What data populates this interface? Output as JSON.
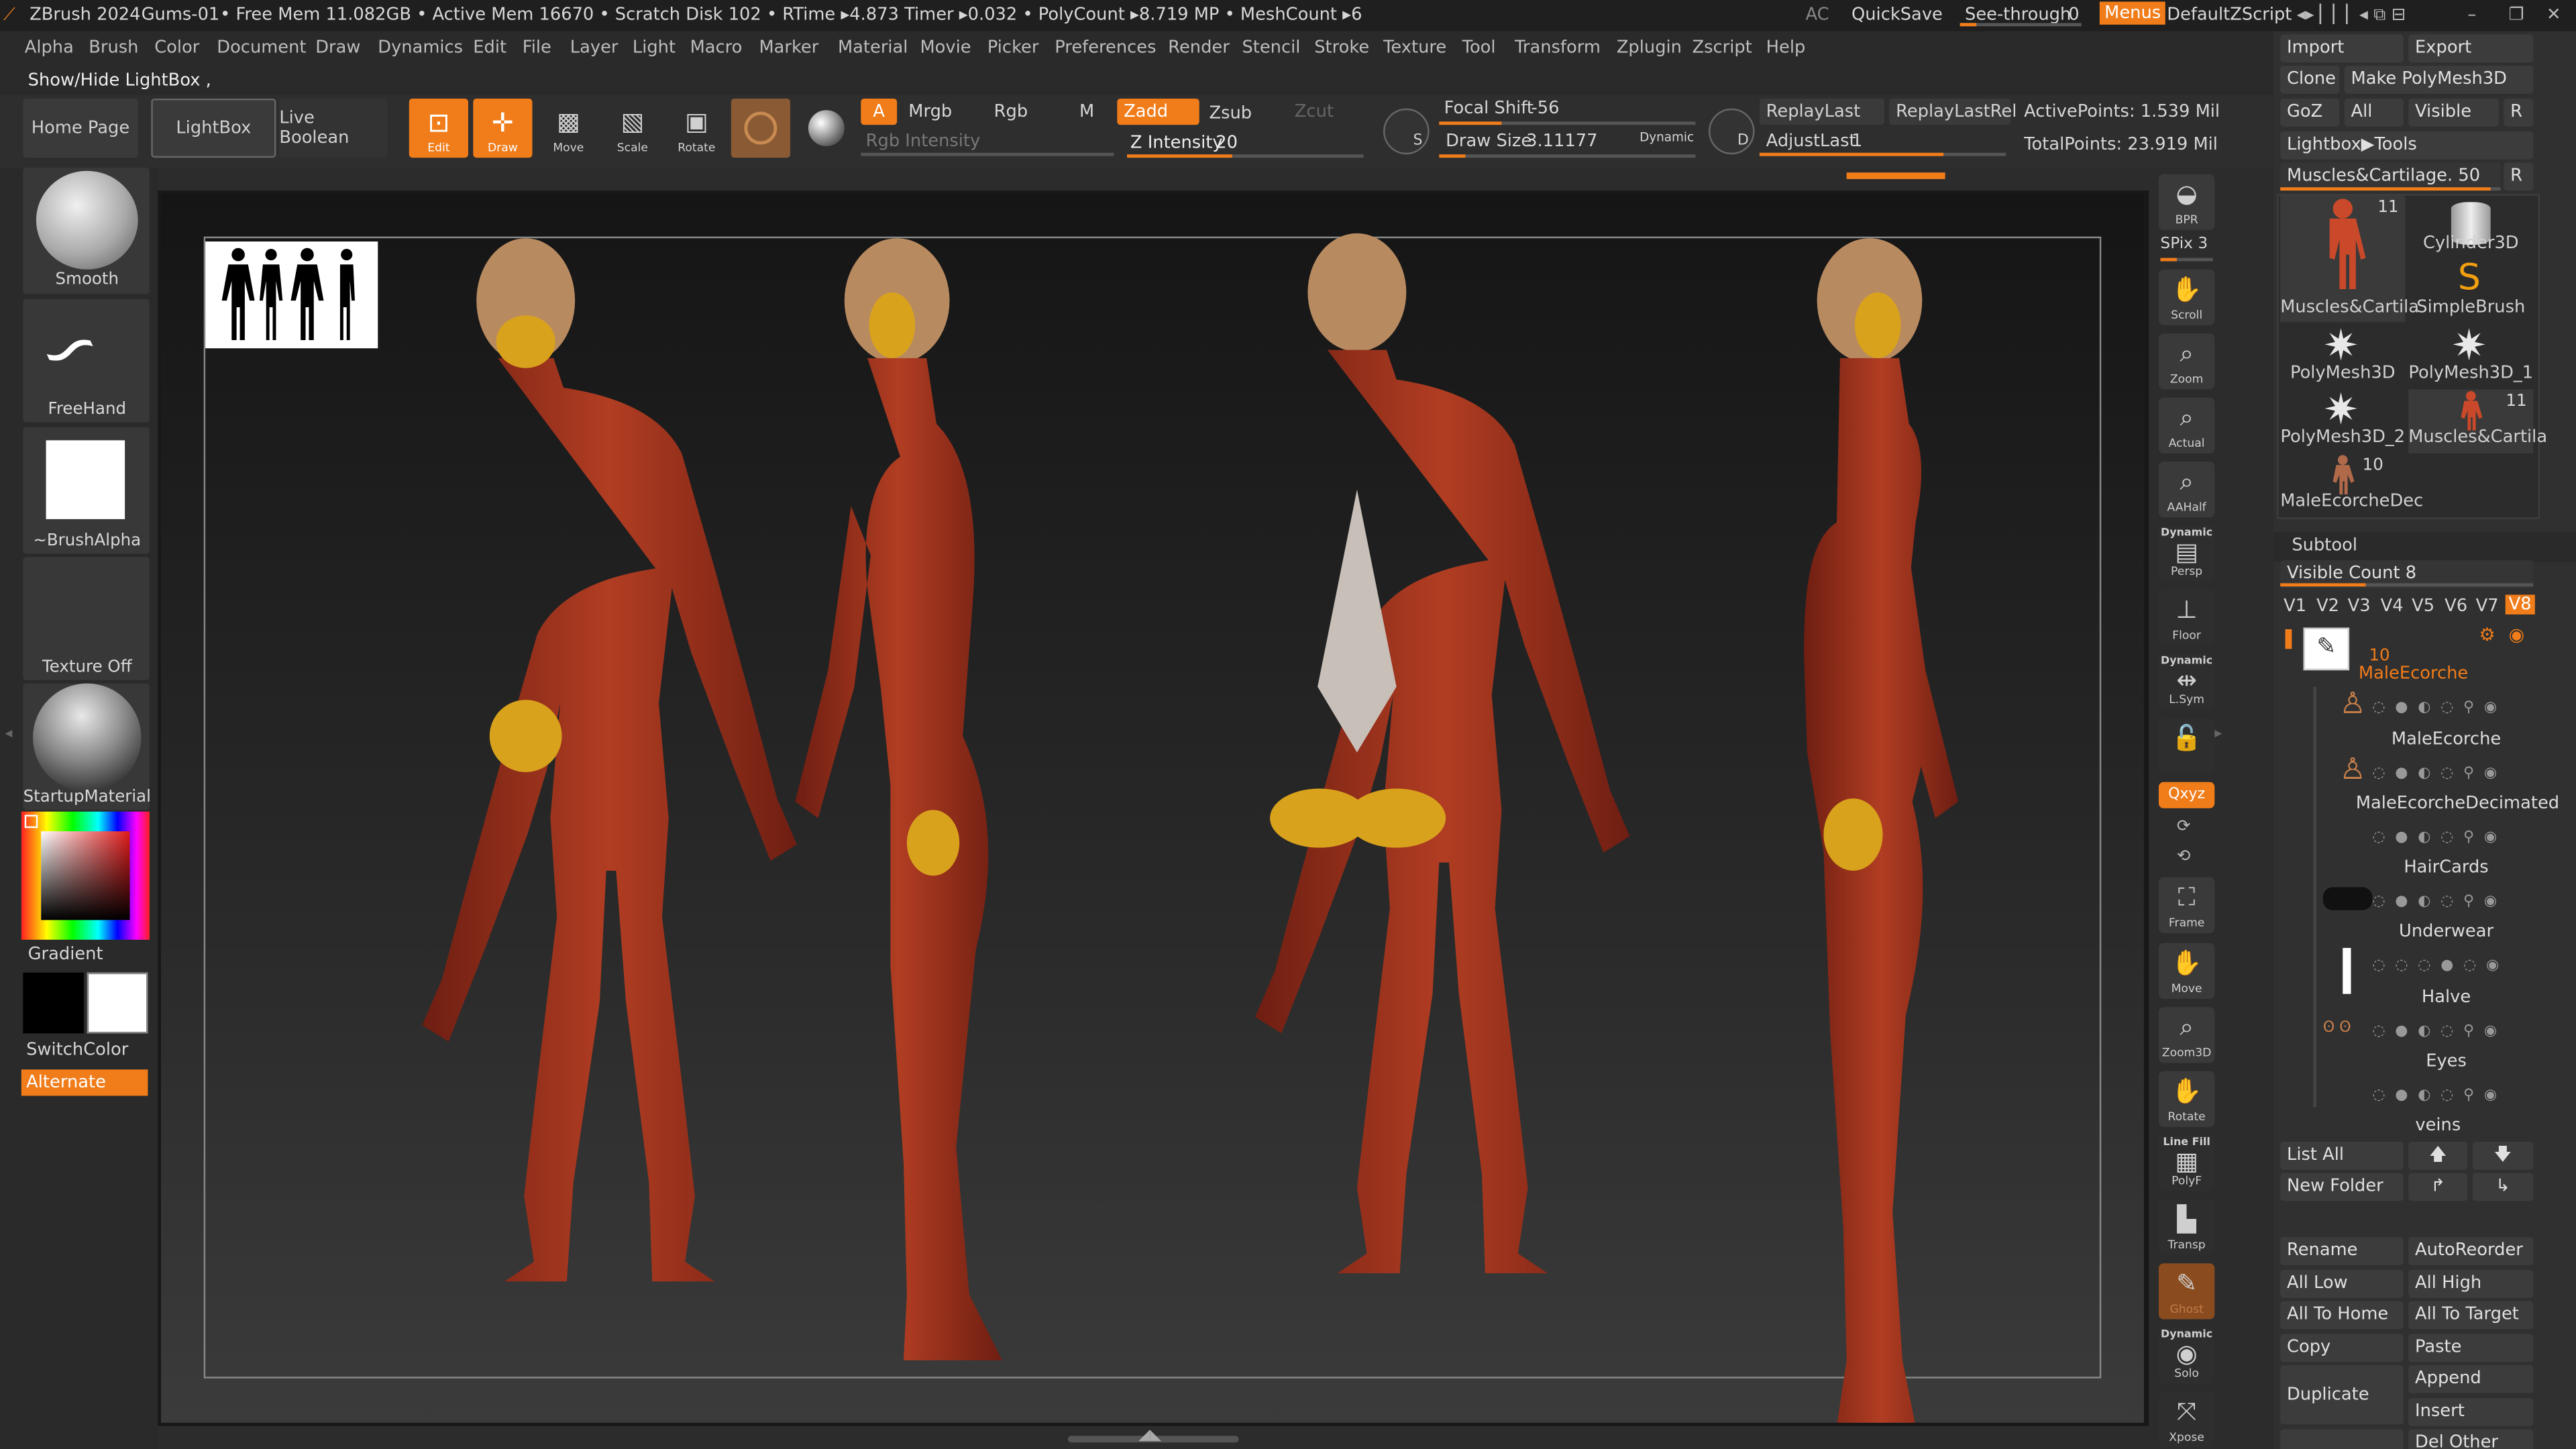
{
  "titlebar": {
    "app": "ZBrush 2024",
    "doc": "Gums-01",
    "stats": "• Free Mem 11.082GB • Active Mem 16670 • Scratch Disk 102 • RTime ▸4.873 Timer ▸0.032 • PolyCount ▸8.719 MP • MeshCount ▸6",
    "ac": "AC",
    "quicksave": "QuickSave",
    "see_through": "See-through",
    "see_through_value": "0",
    "menus": "Menus",
    "default_zscript": "DefaultZScript"
  },
  "menubar": [
    "Alpha",
    "Brush",
    "Color",
    "Document",
    "Draw",
    "Dynamics",
    "Edit",
    "File",
    "Layer",
    "Light",
    "Macro",
    "Marker",
    "Material",
    "Movie",
    "Picker",
    "Preferences",
    "Render",
    "Stencil",
    "Stroke",
    "Texture",
    "Tool",
    "Transform",
    "Zplugin",
    "Zscript",
    "Help"
  ],
  "status_message": "Show/Hide LightBox ,",
  "toolbar": {
    "home_page": "Home Page",
    "lightbox": "LightBox",
    "live_boolean": "Live Boolean",
    "edit": "Edit",
    "draw": "Draw",
    "move": "Move",
    "scale": "Scale",
    "rotate": "Rotate",
    "a": "A",
    "mrgb": "Mrgb",
    "rgb": "Rgb",
    "m": "M",
    "rgb_intensity": "Rgb Intensity",
    "zadd": "Zadd",
    "zsub": "Zsub",
    "zcut": "Zcut",
    "z_intensity_label": "Z Intensity",
    "z_intensity_value": "20",
    "focal_shift_label": "Focal Shift",
    "focal_shift_value": "-56",
    "draw_size_label": "Draw Size",
    "draw_size_value": "3.11177",
    "dynamic": "Dynamic",
    "replay_last": "ReplayLast",
    "replay_last_rel": "ReplayLastRel",
    "adjust_last": "AdjustLast",
    "adjust_last_value": "1",
    "active_points": "ActivePoints: 1.539 Mil",
    "total_points": "TotalPoints: 23.919 Mil",
    "s": "S",
    "d": "D"
  },
  "left_tray": {
    "brush": "Smooth",
    "stroke": "FreeHand",
    "alpha": "~BrushAlpha",
    "texture": "Texture Off",
    "material": "StartupMaterial",
    "gradient": "Gradient",
    "switch_color": "SwitchColor",
    "alternate": "Alternate"
  },
  "right_shelf": {
    "bpr": "BPR",
    "spix": "SPix 3",
    "scroll": "Scroll",
    "zoom": "Zoom",
    "actual": "Actual",
    "aahalf": "AAHalf",
    "dynamic_persp": "Dynamic",
    "persp": "Persp",
    "floor": "Floor",
    "dynamic_lsym": "Dynamic",
    "lsym": "L.Sym",
    "xyz": "Qxyz",
    "frame": "Frame",
    "move": "Move",
    "zoom3d": "Zoom3D",
    "rotate": "Rotate",
    "line_fill": "Line Fill",
    "polyf": "PolyF",
    "transp": "Transp",
    "ghost": "Ghost",
    "dynamic_solo": "Dynamic",
    "solo": "Solo",
    "xpose": "Xpose"
  },
  "right_panel": {
    "import": "Import",
    "export": "Export",
    "clone": "Clone",
    "make_polymesh": "Make PolyMesh3D",
    "goz": "GoZ",
    "all": "All",
    "visible": "Visible",
    "r": "R",
    "lightbox_tools": "Lightbox▶Tools",
    "current_tool": "Muscles&Cartilage. 50",
    "r2": "R",
    "tools": [
      {
        "name": "Muscles&Cartila",
        "count": "11"
      },
      {
        "name": "Cylinder3D",
        "count": ""
      },
      {
        "name": "SimpleBrush",
        "count": ""
      },
      {
        "name": "PolyMesh3D",
        "count": ""
      },
      {
        "name": "PolyMesh3D_1",
        "count": ""
      },
      {
        "name": "PolyMesh3D_2",
        "count": ""
      },
      {
        "name": "Muscles&Cartila",
        "count": "11"
      },
      {
        "name": "MaleEcorcheDec",
        "count": "10"
      }
    ],
    "subtool_header": "Subtool",
    "visible_count": "Visible Count 8",
    "versions": [
      "V1",
      "V2",
      "V3",
      "V4",
      "V5",
      "V6",
      "V7",
      "V8"
    ],
    "subtool_count": "10",
    "subtools": [
      "MaleEcorche",
      "MaleEcorche",
      "MaleEcorcheDecimated",
      "HairCards",
      "Underwear",
      "Halve",
      "Eyes",
      "veins"
    ],
    "list_all": "List All",
    "new_folder": "New Folder",
    "rename": "Rename",
    "auto_reorder": "AutoReorder",
    "all_low": "All Low",
    "all_high": "All High",
    "all_to_home": "All To Home",
    "all_to_target": "All To Target",
    "copy": "Copy",
    "paste": "Paste",
    "duplicate": "Duplicate",
    "append": "Append",
    "insert": "Insert",
    "del_other": "Del Other"
  },
  "colors": {
    "accent": "#f07c1a",
    "panel": "#303030",
    "canvas_top": "#151515",
    "muscle": "#a5341e"
  }
}
